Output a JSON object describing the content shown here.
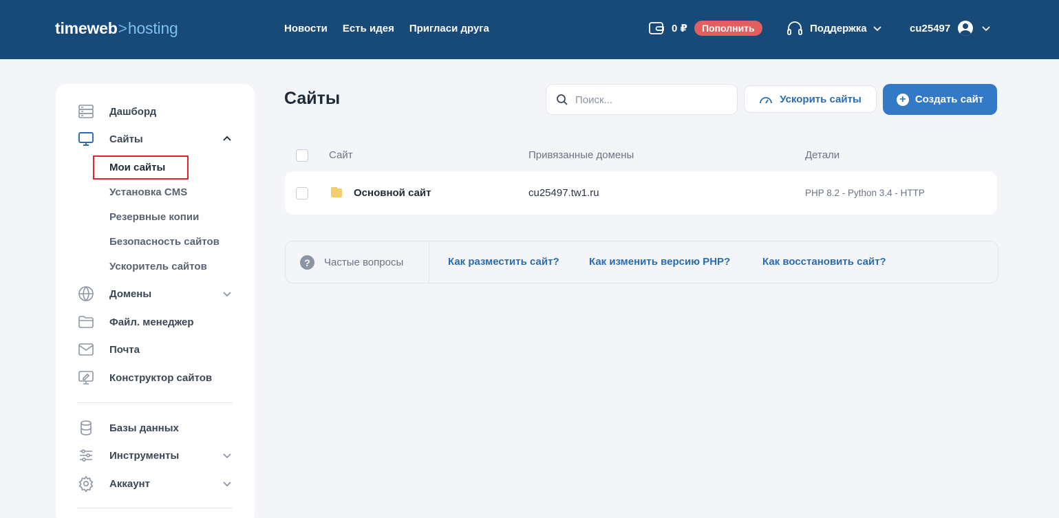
{
  "header": {
    "logo_main": "timeweb",
    "logo_sep": ">",
    "logo_sub": "hosting",
    "nav": [
      "Новости",
      "Есть идея",
      "Пригласи друга"
    ],
    "balance": "0 ₽",
    "topup_label": "Пополнить",
    "support_label": "Поддержка",
    "username": "cu25497"
  },
  "sidebar": {
    "dashboard": "Дашборд",
    "sites": "Сайты",
    "sites_sub": [
      "Мои сайты",
      "Установка CMS",
      "Резервные копии",
      "Безопасность сайтов",
      "Ускоритель сайтов"
    ],
    "domains": "Домены",
    "file_manager": "Файл. менеджер",
    "mail": "Почта",
    "builder": "Конструктор сайтов",
    "databases": "Базы данных",
    "tools": "Инструменты",
    "account": "Аккаунт"
  },
  "main": {
    "title": "Сайты",
    "search_placeholder": "Поиск...",
    "speed_button": "Ускорить сайты",
    "create_button": "Создать сайт",
    "columns": [
      "Сайт",
      "Привязанные домены",
      "Детали"
    ],
    "rows": [
      {
        "name": "Основной сайт",
        "domain": "cu25497.tw1.ru",
        "details": "PHP 8.2 - Python 3.4 - HTTP"
      }
    ],
    "faq_label": "Частые вопросы",
    "faq_links": [
      "Как разместить сайт?",
      "Как изменить версию PHP?",
      "Как восстановить сайт?"
    ]
  }
}
